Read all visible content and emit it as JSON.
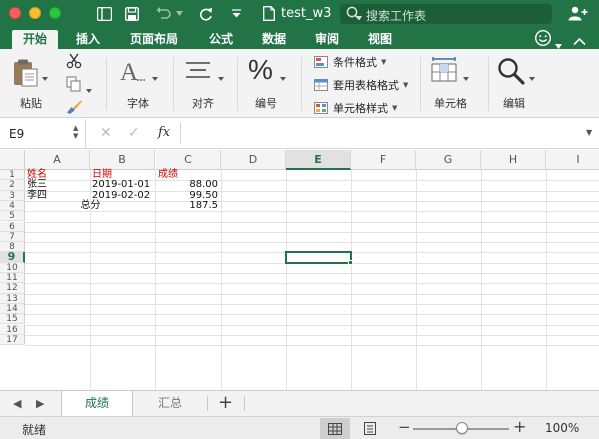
{
  "titlebar": {
    "filename": "test_w3",
    "search_placeholder": "搜索工作表",
    "icons": [
      "sidebar-icon",
      "save-icon",
      "undo-icon",
      "redo-icon",
      "customize-icon",
      "document-icon",
      "search-icon",
      "add-person-icon"
    ]
  },
  "ribbon_tabs": [
    "开始",
    "插入",
    "页面布局",
    "公式",
    "数据",
    "审阅",
    "视图"
  ],
  "ribbon_tab_selected": "开始",
  "ribbon": {
    "paste_label": "粘贴",
    "font_label": "字体",
    "align_label": "对齐",
    "number_label": "编号",
    "number_glyph": "%",
    "cond_format": "条件格式",
    "table_format": "套用表格格式",
    "cell_style": "单元格样式",
    "cells_label": "单元格",
    "editing_label": "编辑"
  },
  "formula_bar": {
    "name_box": "E9",
    "fx_label": "fx",
    "formula": ""
  },
  "columns": [
    "A",
    "B",
    "C",
    "D",
    "E",
    "F",
    "G",
    "H",
    "I"
  ],
  "rows": [
    "1",
    "2",
    "3",
    "4",
    "5",
    "6",
    "7",
    "8",
    "9",
    "10",
    "11",
    "12",
    "13",
    "14",
    "15",
    "16",
    "17"
  ],
  "selected_cell": "E9",
  "cells": {
    "A1": "姓名",
    "B1": "日期",
    "C1": "成绩",
    "A2": "张三",
    "B2": "2019-01-01",
    "C2": "88.00",
    "A3": "李四",
    "B3": "2019-02-02",
    "C3": "99.50",
    "A4": "总分",
    "C4": "187.5"
  },
  "sheets": [
    "成绩",
    "汇总"
  ],
  "active_sheet": "成绩",
  "status": {
    "text": "就绪",
    "zoom": "100%",
    "zoom_level": 100
  },
  "colors": {
    "accent": "#227447",
    "header_text": "#d00000"
  }
}
